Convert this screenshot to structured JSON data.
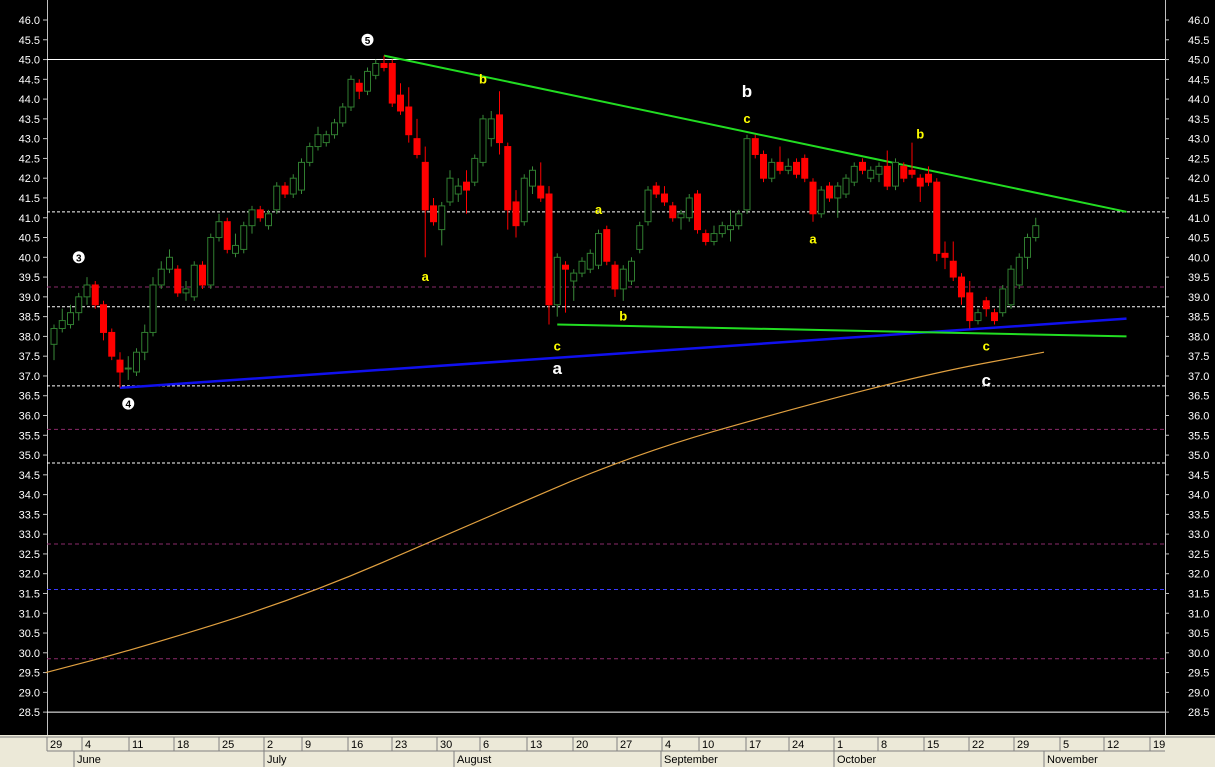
{
  "chart_data": {
    "type": "candlestick",
    "title": "",
    "xlabel": "",
    "ylabel": "",
    "ylim": [
      28.2,
      46.4
    ],
    "y_ticks": [
      28.5,
      29.0,
      29.5,
      30.0,
      30.5,
      31.0,
      31.5,
      32.0,
      32.5,
      33.0,
      33.5,
      34.0,
      34.5,
      35.0,
      35.5,
      36.0,
      36.5,
      37.0,
      37.5,
      38.0,
      38.5,
      39.0,
      39.5,
      40.0,
      40.5,
      41.0,
      41.5,
      42.0,
      42.5,
      43.0,
      43.5,
      44.0,
      44.5,
      45.0,
      45.5,
      46.0
    ],
    "x_day_ticks": [
      "29",
      "4",
      "11",
      "18",
      "25",
      "2",
      "9",
      "16",
      "23",
      "30",
      "6",
      "13",
      "20",
      "27",
      "4",
      "10",
      "17",
      "24",
      "1",
      "8",
      "15",
      "22",
      "29",
      "5",
      "12",
      "19"
    ],
    "x_month_labels": [
      "June",
      "July",
      "August",
      "September",
      "October",
      "November"
    ],
    "colors": {
      "background": "#000000",
      "up_candle": "#2f7d2f",
      "down_candle": "#ff0000",
      "resistance_line": "#22dd22",
      "support_line": "#1010ee",
      "moving_average": "#e0a040",
      "hline_solid": "#ffffff",
      "hline_white_dash": "#ffffff",
      "hline_purple_dash": "#8a2a6a",
      "hline_blue_dash": "#3a3aff",
      "wave_label_yellow": "#ffff00",
      "wave_label_white": "#ffffff"
    },
    "candles": [
      {
        "o": 37.8,
        "h": 38.3,
        "l": 37.4,
        "c": 38.2
      },
      {
        "o": 38.2,
        "h": 38.7,
        "l": 38.1,
        "c": 38.4
      },
      {
        "o": 38.3,
        "h": 38.8,
        "l": 38.2,
        "c": 38.6
      },
      {
        "o": 38.6,
        "h": 39.1,
        "l": 38.4,
        "c": 39.0
      },
      {
        "o": 39.0,
        "h": 39.5,
        "l": 38.8,
        "c": 39.3
      },
      {
        "o": 39.3,
        "h": 39.4,
        "l": 38.7,
        "c": 38.8
      },
      {
        "o": 38.8,
        "h": 38.9,
        "l": 37.9,
        "c": 38.1
      },
      {
        "o": 38.1,
        "h": 38.2,
        "l": 37.4,
        "c": 37.5
      },
      {
        "o": 37.4,
        "h": 37.6,
        "l": 36.7,
        "c": 37.1
      },
      {
        "o": 37.2,
        "h": 37.5,
        "l": 36.9,
        "c": 37.2
      },
      {
        "o": 37.1,
        "h": 37.7,
        "l": 37.0,
        "c": 37.6
      },
      {
        "o": 37.6,
        "h": 38.3,
        "l": 37.4,
        "c": 38.1
      },
      {
        "o": 38.1,
        "h": 39.5,
        "l": 38.0,
        "c": 39.3
      },
      {
        "o": 39.3,
        "h": 39.9,
        "l": 39.2,
        "c": 39.7
      },
      {
        "o": 39.7,
        "h": 40.2,
        "l": 39.6,
        "c": 40.0
      },
      {
        "o": 39.7,
        "h": 39.8,
        "l": 39.0,
        "c": 39.1
      },
      {
        "o": 39.1,
        "h": 39.4,
        "l": 38.9,
        "c": 39.2
      },
      {
        "o": 39.0,
        "h": 39.9,
        "l": 38.9,
        "c": 39.8
      },
      {
        "o": 39.8,
        "h": 39.9,
        "l": 39.2,
        "c": 39.3
      },
      {
        "o": 39.3,
        "h": 40.6,
        "l": 39.2,
        "c": 40.5
      },
      {
        "o": 40.5,
        "h": 41.1,
        "l": 40.4,
        "c": 40.9
      },
      {
        "o": 40.9,
        "h": 41.0,
        "l": 40.1,
        "c": 40.2
      },
      {
        "o": 40.1,
        "h": 40.6,
        "l": 40.0,
        "c": 40.3
      },
      {
        "o": 40.2,
        "h": 40.9,
        "l": 40.1,
        "c": 40.8
      },
      {
        "o": 40.8,
        "h": 41.3,
        "l": 40.6,
        "c": 41.2
      },
      {
        "o": 41.2,
        "h": 41.3,
        "l": 40.9,
        "c": 41.0
      },
      {
        "o": 40.8,
        "h": 41.2,
        "l": 40.7,
        "c": 41.1
      },
      {
        "o": 41.2,
        "h": 41.9,
        "l": 41.1,
        "c": 41.8
      },
      {
        "o": 41.8,
        "h": 41.9,
        "l": 41.5,
        "c": 41.6
      },
      {
        "o": 41.6,
        "h": 42.1,
        "l": 41.5,
        "c": 42.0
      },
      {
        "o": 41.7,
        "h": 42.5,
        "l": 41.6,
        "c": 42.4
      },
      {
        "o": 42.4,
        "h": 42.9,
        "l": 42.3,
        "c": 42.8
      },
      {
        "o": 42.8,
        "h": 43.3,
        "l": 42.7,
        "c": 43.1
      },
      {
        "o": 42.9,
        "h": 43.2,
        "l": 42.8,
        "c": 43.1
      },
      {
        "o": 43.1,
        "h": 43.5,
        "l": 43.0,
        "c": 43.4
      },
      {
        "o": 43.4,
        "h": 43.9,
        "l": 43.3,
        "c": 43.8
      },
      {
        "o": 43.8,
        "h": 44.6,
        "l": 43.7,
        "c": 44.5
      },
      {
        "o": 44.4,
        "h": 44.5,
        "l": 44.0,
        "c": 44.2
      },
      {
        "o": 44.2,
        "h": 44.8,
        "l": 44.1,
        "c": 44.7
      },
      {
        "o": 44.6,
        "h": 45.0,
        "l": 44.5,
        "c": 44.9
      },
      {
        "o": 44.9,
        "h": 45.1,
        "l": 44.7,
        "c": 44.8
      },
      {
        "o": 44.9,
        "h": 45.0,
        "l": 43.8,
        "c": 43.9
      },
      {
        "o": 44.1,
        "h": 44.4,
        "l": 43.6,
        "c": 43.7
      },
      {
        "o": 43.8,
        "h": 44.3,
        "l": 42.9,
        "c": 43.1
      },
      {
        "o": 43.0,
        "h": 43.5,
        "l": 42.5,
        "c": 42.6
      },
      {
        "o": 42.4,
        "h": 42.8,
        "l": 40.0,
        "c": 41.2
      },
      {
        "o": 41.3,
        "h": 41.5,
        "l": 40.8,
        "c": 40.9
      },
      {
        "o": 40.7,
        "h": 41.4,
        "l": 40.3,
        "c": 41.3
      },
      {
        "o": 41.4,
        "h": 42.2,
        "l": 41.3,
        "c": 42.0
      },
      {
        "o": 41.6,
        "h": 42.0,
        "l": 41.4,
        "c": 41.8
      },
      {
        "o": 41.9,
        "h": 42.2,
        "l": 41.1,
        "c": 41.7
      },
      {
        "o": 41.9,
        "h": 42.6,
        "l": 41.8,
        "c": 42.5
      },
      {
        "o": 42.4,
        "h": 43.6,
        "l": 42.3,
        "c": 43.5
      },
      {
        "o": 43.0,
        "h": 43.7,
        "l": 42.8,
        "c": 43.5
      },
      {
        "o": 43.6,
        "h": 44.2,
        "l": 42.6,
        "c": 42.9
      },
      {
        "o": 42.8,
        "h": 42.9,
        "l": 40.7,
        "c": 41.2
      },
      {
        "o": 41.4,
        "h": 41.7,
        "l": 40.5,
        "c": 40.8
      },
      {
        "o": 40.9,
        "h": 42.1,
        "l": 40.8,
        "c": 42.0
      },
      {
        "o": 41.8,
        "h": 42.3,
        "l": 41.6,
        "c": 42.2
      },
      {
        "o": 41.8,
        "h": 42.4,
        "l": 41.4,
        "c": 41.5
      },
      {
        "o": 41.6,
        "h": 41.8,
        "l": 38.3,
        "c": 38.8
      },
      {
        "o": 38.8,
        "h": 40.1,
        "l": 38.5,
        "c": 40.0
      },
      {
        "o": 39.8,
        "h": 39.9,
        "l": 38.6,
        "c": 39.7
      },
      {
        "o": 39.4,
        "h": 39.7,
        "l": 38.9,
        "c": 39.6
      },
      {
        "o": 39.6,
        "h": 40.0,
        "l": 39.5,
        "c": 39.9
      },
      {
        "o": 39.7,
        "h": 40.2,
        "l": 39.6,
        "c": 40.1
      },
      {
        "o": 39.8,
        "h": 40.7,
        "l": 39.7,
        "c": 40.6
      },
      {
        "o": 40.7,
        "h": 40.8,
        "l": 39.8,
        "c": 39.9
      },
      {
        "o": 39.8,
        "h": 39.9,
        "l": 39.0,
        "c": 39.2
      },
      {
        "o": 39.2,
        "h": 39.8,
        "l": 38.9,
        "c": 39.7
      },
      {
        "o": 39.4,
        "h": 40.0,
        "l": 39.3,
        "c": 39.9
      },
      {
        "o": 40.2,
        "h": 40.9,
        "l": 40.1,
        "c": 40.8
      },
      {
        "o": 40.9,
        "h": 41.8,
        "l": 40.8,
        "c": 41.7
      },
      {
        "o": 41.8,
        "h": 41.9,
        "l": 41.5,
        "c": 41.6
      },
      {
        "o": 41.6,
        "h": 41.8,
        "l": 41.3,
        "c": 41.4
      },
      {
        "o": 41.3,
        "h": 41.4,
        "l": 40.9,
        "c": 41.0
      },
      {
        "o": 41.0,
        "h": 41.2,
        "l": 40.7,
        "c": 41.1
      },
      {
        "o": 41.0,
        "h": 41.6,
        "l": 40.9,
        "c": 41.5
      },
      {
        "o": 41.6,
        "h": 41.7,
        "l": 40.6,
        "c": 40.7
      },
      {
        "o": 40.6,
        "h": 40.7,
        "l": 40.3,
        "c": 40.4
      },
      {
        "o": 40.4,
        "h": 40.8,
        "l": 40.3,
        "c": 40.6
      },
      {
        "o": 40.6,
        "h": 40.9,
        "l": 40.5,
        "c": 40.8
      },
      {
        "o": 40.7,
        "h": 41.2,
        "l": 40.4,
        "c": 40.8
      },
      {
        "o": 40.8,
        "h": 41.2,
        "l": 40.7,
        "c": 41.1
      },
      {
        "o": 41.2,
        "h": 43.1,
        "l": 41.1,
        "c": 43.0
      },
      {
        "o": 43.0,
        "h": 43.1,
        "l": 42.5,
        "c": 42.6
      },
      {
        "o": 42.6,
        "h": 42.7,
        "l": 41.9,
        "c": 42.0
      },
      {
        "o": 42.0,
        "h": 42.5,
        "l": 41.9,
        "c": 42.4
      },
      {
        "o": 42.4,
        "h": 42.8,
        "l": 42.1,
        "c": 42.2
      },
      {
        "o": 42.2,
        "h": 42.5,
        "l": 42.1,
        "c": 42.3
      },
      {
        "o": 42.4,
        "h": 42.5,
        "l": 42.0,
        "c": 42.1
      },
      {
        "o": 42.5,
        "h": 42.6,
        "l": 41.9,
        "c": 42.0
      },
      {
        "o": 41.9,
        "h": 42.0,
        "l": 40.9,
        "c": 41.1
      },
      {
        "o": 41.1,
        "h": 41.8,
        "l": 41.0,
        "c": 41.7
      },
      {
        "o": 41.8,
        "h": 41.9,
        "l": 41.4,
        "c": 41.5
      },
      {
        "o": 41.5,
        "h": 41.9,
        "l": 41.0,
        "c": 41.8
      },
      {
        "o": 41.6,
        "h": 42.1,
        "l": 41.5,
        "c": 42.0
      },
      {
        "o": 41.9,
        "h": 42.4,
        "l": 41.8,
        "c": 42.3
      },
      {
        "o": 42.4,
        "h": 42.5,
        "l": 42.1,
        "c": 42.2
      },
      {
        "o": 42.0,
        "h": 42.3,
        "l": 41.9,
        "c": 42.2
      },
      {
        "o": 42.1,
        "h": 42.4,
        "l": 41.9,
        "c": 42.3
      },
      {
        "o": 42.3,
        "h": 42.7,
        "l": 41.7,
        "c": 41.8
      },
      {
        "o": 41.8,
        "h": 42.5,
        "l": 41.7,
        "c": 42.4
      },
      {
        "o": 42.3,
        "h": 42.4,
        "l": 41.9,
        "c": 42.0
      },
      {
        "o": 42.2,
        "h": 42.9,
        "l": 42.0,
        "c": 42.1
      },
      {
        "o": 42.0,
        "h": 42.1,
        "l": 41.4,
        "c": 41.8
      },
      {
        "o": 42.1,
        "h": 42.3,
        "l": 41.8,
        "c": 41.9
      },
      {
        "o": 41.9,
        "h": 42.0,
        "l": 39.9,
        "c": 40.1
      },
      {
        "o": 40.1,
        "h": 40.4,
        "l": 39.7,
        "c": 40.0
      },
      {
        "o": 39.9,
        "h": 40.4,
        "l": 39.4,
        "c": 39.5
      },
      {
        "o": 39.5,
        "h": 39.6,
        "l": 38.8,
        "c": 39.0
      },
      {
        "o": 39.1,
        "h": 39.4,
        "l": 38.2,
        "c": 38.4
      },
      {
        "o": 38.4,
        "h": 38.7,
        "l": 38.3,
        "c": 38.6
      },
      {
        "o": 38.9,
        "h": 39.0,
        "l": 38.5,
        "c": 38.7
      },
      {
        "o": 38.6,
        "h": 38.7,
        "l": 38.3,
        "c": 38.4
      },
      {
        "o": 38.6,
        "h": 39.3,
        "l": 38.5,
        "c": 39.2
      },
      {
        "o": 38.8,
        "h": 39.8,
        "l": 38.7,
        "c": 39.7
      },
      {
        "o": 39.3,
        "h": 40.1,
        "l": 39.2,
        "c": 40.0
      },
      {
        "o": 40.0,
        "h": 40.6,
        "l": 39.7,
        "c": 40.5
      },
      {
        "o": 40.5,
        "h": 41.0,
        "l": 40.4,
        "c": 40.8
      }
    ],
    "moving_average": [
      {
        "i": -1,
        "v": 29.5
      },
      {
        "i": 10,
        "v": 30.1
      },
      {
        "i": 30,
        "v": 31.4
      },
      {
        "i": 50,
        "v": 33.2
      },
      {
        "i": 70,
        "v": 35.0
      },
      {
        "i": 90,
        "v": 36.2
      },
      {
        "i": 107,
        "v": 37.1
      },
      {
        "i": 120,
        "v": 37.6
      }
    ],
    "trendlines": [
      {
        "name": "resistance",
        "color": "resistance_line",
        "from": {
          "i": 40,
          "v": 45.1
        },
        "to": {
          "i": 130,
          "v": 41.15
        }
      },
      {
        "name": "support",
        "color": "support_line",
        "from": {
          "i": 8,
          "v": 36.7
        },
        "to": {
          "i": 130,
          "v": 38.45
        }
      },
      {
        "name": "lower-channel",
        "color": "resistance_line",
        "from": {
          "i": 61,
          "v": 38.3
        },
        "to": {
          "i": 130,
          "v": 38.0
        }
      }
    ],
    "horizontal_lines": [
      {
        "v": 45.0,
        "style": "hline_solid"
      },
      {
        "v": 41.15,
        "style": "hline_white_dash"
      },
      {
        "v": 39.25,
        "style": "hline_purple_dash"
      },
      {
        "v": 38.75,
        "style": "hline_white_dash"
      },
      {
        "v": 36.75,
        "style": "hline_white_dash"
      },
      {
        "v": 35.65,
        "style": "hline_purple_dash"
      },
      {
        "v": 34.8,
        "style": "hline_white_dash"
      },
      {
        "v": 32.75,
        "style": "hline_purple_dash"
      },
      {
        "v": 31.6,
        "style": "hline_blue_dash"
      },
      {
        "v": 29.85,
        "style": "hline_purple_dash"
      },
      {
        "v": 28.5,
        "style": "hline_solid"
      }
    ],
    "annotations": [
      {
        "text": "3",
        "kind": "circle",
        "i": 3,
        "v": 40.0
      },
      {
        "text": "4",
        "kind": "circle",
        "i": 9,
        "v": 36.3
      },
      {
        "text": "5",
        "kind": "circle",
        "i": 38,
        "v": 45.5
      },
      {
        "text": "b",
        "kind": "yellow",
        "i": 52,
        "v": 44.5
      },
      {
        "text": "a",
        "kind": "yellow",
        "i": 45,
        "v": 39.5
      },
      {
        "text": "c",
        "kind": "yellow",
        "i": 61,
        "v": 37.75
      },
      {
        "text": "a",
        "kind": "white_large",
        "i": 61,
        "v": 37.2
      },
      {
        "text": "a",
        "kind": "yellow",
        "i": 66,
        "v": 41.2
      },
      {
        "text": "b",
        "kind": "yellow",
        "i": 69,
        "v": 38.5
      },
      {
        "text": "b",
        "kind": "white_large",
        "i": 84,
        "v": 44.2
      },
      {
        "text": "c",
        "kind": "yellow",
        "i": 84,
        "v": 43.5
      },
      {
        "text": "a",
        "kind": "yellow",
        "i": 92,
        "v": 40.45
      },
      {
        "text": "b",
        "kind": "yellow",
        "i": 105,
        "v": 43.1
      },
      {
        "text": "c",
        "kind": "yellow",
        "i": 113,
        "v": 37.75
      },
      {
        "text": "c",
        "kind": "white_large",
        "i": 113,
        "v": 36.9
      }
    ]
  }
}
